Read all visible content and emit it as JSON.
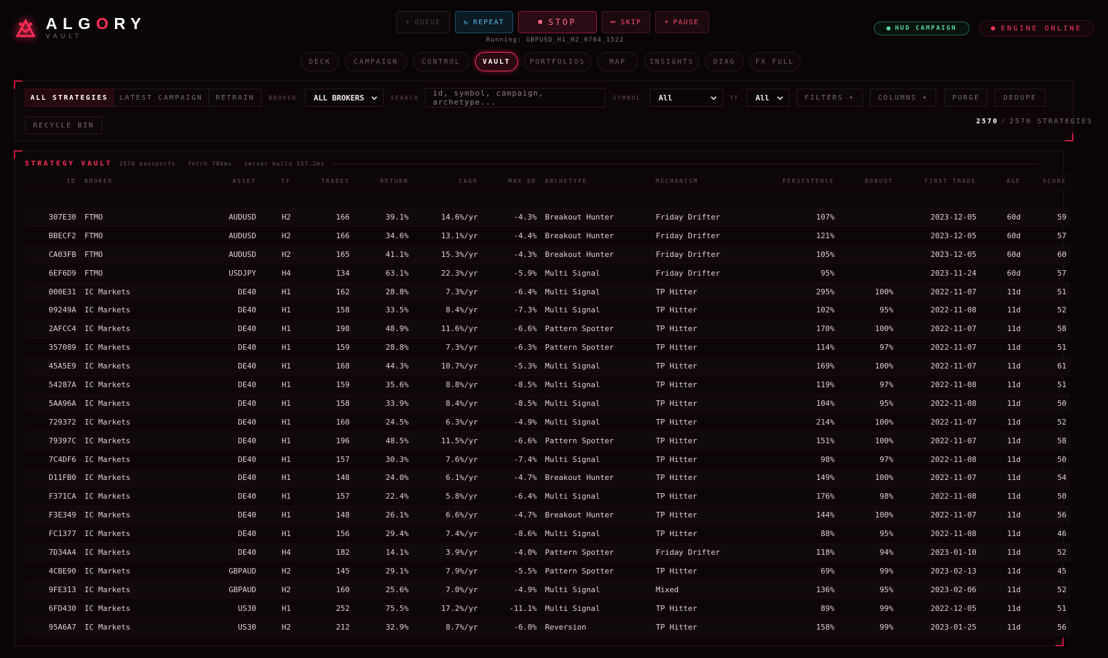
{
  "app": {
    "title": "ALGORY",
    "subtitle": "VAULT"
  },
  "controls": {
    "queue": "QUEUE",
    "repeat": "REPEAT",
    "stop": "STOP",
    "skip": "SKIP",
    "pause": "PAUSE",
    "running": "Running: GBPUSD_H1_H2_0704_1522"
  },
  "status": {
    "hud": "HUD CAMPAIGN",
    "engine": "ENGINE ONLINE",
    "hud_color": "#5bd8a0",
    "engine_color": "#ff3a5e"
  },
  "nav": {
    "tabs": [
      "DECK",
      "CAMPAIGN",
      "CONTROL",
      "VAULT",
      "PORTFOLIOS",
      "MAP",
      "INSIGHTS",
      "DIAG",
      "FX FULL"
    ],
    "active": "VAULT"
  },
  "filters": {
    "modes": [
      "ALL STRATEGIES",
      "LATEST CAMPAIGN",
      "RETRAIN"
    ],
    "active_mode": "ALL STRATEGIES",
    "broker_label": "BROKER",
    "broker_value": "ALL BROKERS",
    "search_label": "SEARCH",
    "search_placeholder": "id, symbol, campaign, archetype...",
    "symbol_label": "SYMBOL",
    "symbol_value": "All",
    "tf_label": "TF",
    "tf_value": "All",
    "filters_btn": "FILTERS ▾",
    "columns_btn": "COLUMNS ▾",
    "purge_btn": "PURGE",
    "dedupe_btn": "DEDUPE",
    "recycle_btn": "RECYCLE BIN",
    "count_shown": "2570",
    "count_total": "2570 STRATEGIES"
  },
  "vault": {
    "title": "STRATEGY VAULT",
    "meta": "2570 passports · fetch 786ms · server build 157.2ms",
    "columns": [
      "ID",
      "BROKER",
      "ASSET",
      "TF",
      "TRADES",
      "RETURN",
      "CAGR",
      "MAX DD",
      "ARCHETYPE",
      "MECHANISM",
      "PERSISTENCE",
      "ROBUST",
      "FIRST TRADE",
      "AGE",
      "SCORE"
    ],
    "rows": [
      [
        "307E30",
        "FTMO",
        "AUDUSD",
        "H2",
        "166",
        "39.1%",
        "14.6%/yr",
        "-4.3%",
        "Breakout Hunter",
        "Friday Drifter",
        "107%",
        "",
        "2023-12-05",
        "60d",
        "59"
      ],
      [
        "BBECF2",
        "FTMO",
        "AUDUSD",
        "H2",
        "166",
        "34.6%",
        "13.1%/yr",
        "-4.4%",
        "Breakout Hunter",
        "Friday Drifter",
        "121%",
        "",
        "2023-12-05",
        "60d",
        "57"
      ],
      [
        "CA03FB",
        "FTMO",
        "AUDUSD",
        "H2",
        "165",
        "41.1%",
        "15.3%/yr",
        "-4.3%",
        "Breakout Hunter",
        "Friday Drifter",
        "105%",
        "",
        "2023-12-05",
        "60d",
        "60"
      ],
      [
        "6EF6D9",
        "FTMO",
        "USDJPY",
        "H4",
        "134",
        "63.1%",
        "22.3%/yr",
        "-5.9%",
        "Multi Signal",
        "Friday Drifter",
        "95%",
        "",
        "2023-11-24",
        "60d",
        "57"
      ],
      [
        "000E31",
        "IC Markets",
        "DE40",
        "H1",
        "162",
        "28.8%",
        "7.3%/yr",
        "-6.4%",
        "Multi Signal",
        "TP Hitter",
        "295%",
        "100%",
        "2022-11-07",
        "11d",
        "51"
      ],
      [
        "09249A",
        "IC Markets",
        "DE40",
        "H1",
        "158",
        "33.5%",
        "8.4%/yr",
        "-7.3%",
        "Multi Signal",
        "TP Hitter",
        "102%",
        "95%",
        "2022-11-08",
        "11d",
        "52"
      ],
      [
        "2AFCC4",
        "IC Markets",
        "DE40",
        "H1",
        "198",
        "48.9%",
        "11.6%/yr",
        "-6.6%",
        "Pattern Spotter",
        "TP Hitter",
        "170%",
        "100%",
        "2022-11-07",
        "11d",
        "58"
      ],
      [
        "357089",
        "IC Markets",
        "DE40",
        "H1",
        "159",
        "28.8%",
        "7.3%/yr",
        "-6.3%",
        "Pattern Spotter",
        "TP Hitter",
        "114%",
        "97%",
        "2022-11-07",
        "11d",
        "51"
      ],
      [
        "45A5E9",
        "IC Markets",
        "DE40",
        "H1",
        "168",
        "44.3%",
        "10.7%/yr",
        "-5.3%",
        "Multi Signal",
        "TP Hitter",
        "169%",
        "100%",
        "2022-11-07",
        "11d",
        "61"
      ],
      [
        "54287A",
        "IC Markets",
        "DE40",
        "H1",
        "159",
        "35.6%",
        "8.8%/yr",
        "-8.5%",
        "Multi Signal",
        "TP Hitter",
        "119%",
        "97%",
        "2022-11-08",
        "11d",
        "51"
      ],
      [
        "5AA96A",
        "IC Markets",
        "DE40",
        "H1",
        "158",
        "33.9%",
        "8.4%/yr",
        "-8.5%",
        "Multi Signal",
        "TP Hitter",
        "104%",
        "95%",
        "2022-11-08",
        "11d",
        "50"
      ],
      [
        "729372",
        "IC Markets",
        "DE40",
        "H1",
        "160",
        "24.5%",
        "6.3%/yr",
        "-4.9%",
        "Multi Signal",
        "TP Hitter",
        "214%",
        "100%",
        "2022-11-07",
        "11d",
        "52"
      ],
      [
        "79397C",
        "IC Markets",
        "DE40",
        "H1",
        "196",
        "48.5%",
        "11.5%/yr",
        "-6.6%",
        "Pattern Spotter",
        "TP Hitter",
        "151%",
        "100%",
        "2022-11-07",
        "11d",
        "58"
      ],
      [
        "7C4DF6",
        "IC Markets",
        "DE40",
        "H1",
        "157",
        "30.3%",
        "7.6%/yr",
        "-7.4%",
        "Multi Signal",
        "TP Hitter",
        "98%",
        "97%",
        "2022-11-08",
        "11d",
        "50"
      ],
      [
        "D11FB0",
        "IC Markets",
        "DE40",
        "H1",
        "148",
        "24.0%",
        "6.1%/yr",
        "-4.7%",
        "Breakout Hunter",
        "TP Hitter",
        "149%",
        "100%",
        "2022-11-07",
        "11d",
        "54"
      ],
      [
        "F371CA",
        "IC Markets",
        "DE40",
        "H1",
        "157",
        "22.4%",
        "5.8%/yr",
        "-6.4%",
        "Multi Signal",
        "TP Hitter",
        "176%",
        "98%",
        "2022-11-08",
        "11d",
        "50"
      ],
      [
        "F3E349",
        "IC Markets",
        "DE40",
        "H1",
        "148",
        "26.1%",
        "6.6%/yr",
        "-4.7%",
        "Breakout Hunter",
        "TP Hitter",
        "144%",
        "100%",
        "2022-11-07",
        "11d",
        "56"
      ],
      [
        "FC1377",
        "IC Markets",
        "DE40",
        "H1",
        "156",
        "29.4%",
        "7.4%/yr",
        "-8.6%",
        "Multi Signal",
        "TP Hitter",
        "88%",
        "95%",
        "2022-11-08",
        "11d",
        "46"
      ],
      [
        "7D34A4",
        "IC Markets",
        "DE40",
        "H4",
        "182",
        "14.1%",
        "3.9%/yr",
        "-4.0%",
        "Pattern Spotter",
        "Friday Drifter",
        "118%",
        "94%",
        "2023-01-10",
        "11d",
        "52"
      ],
      [
        "4CBE90",
        "IC Markets",
        "GBPAUD",
        "H2",
        "145",
        "29.1%",
        "7.9%/yr",
        "-5.5%",
        "Pattern Spotter",
        "TP Hitter",
        "69%",
        "99%",
        "2023-02-13",
        "11d",
        "45"
      ],
      [
        "9FE313",
        "IC Markets",
        "GBPAUD",
        "H2",
        "160",
        "25.6%",
        "7.0%/yr",
        "-4.9%",
        "Multi Signal",
        "Mixed",
        "136%",
        "95%",
        "2023-02-06",
        "11d",
        "52"
      ],
      [
        "6FD430",
        "IC Markets",
        "US30",
        "H1",
        "252",
        "75.5%",
        "17.2%/yr",
        "-11.1%",
        "Multi Signal",
        "TP Hitter",
        "89%",
        "99%",
        "2022-12-05",
        "11d",
        "51"
      ],
      [
        "95A6A7",
        "IC Markets",
        "US30",
        "H2",
        "212",
        "32.9%",
        "8.7%/yr",
        "-6.0%",
        "Reversion",
        "TP Hitter",
        "158%",
        "99%",
        "2023-01-25",
        "11d",
        "56"
      ]
    ]
  }
}
